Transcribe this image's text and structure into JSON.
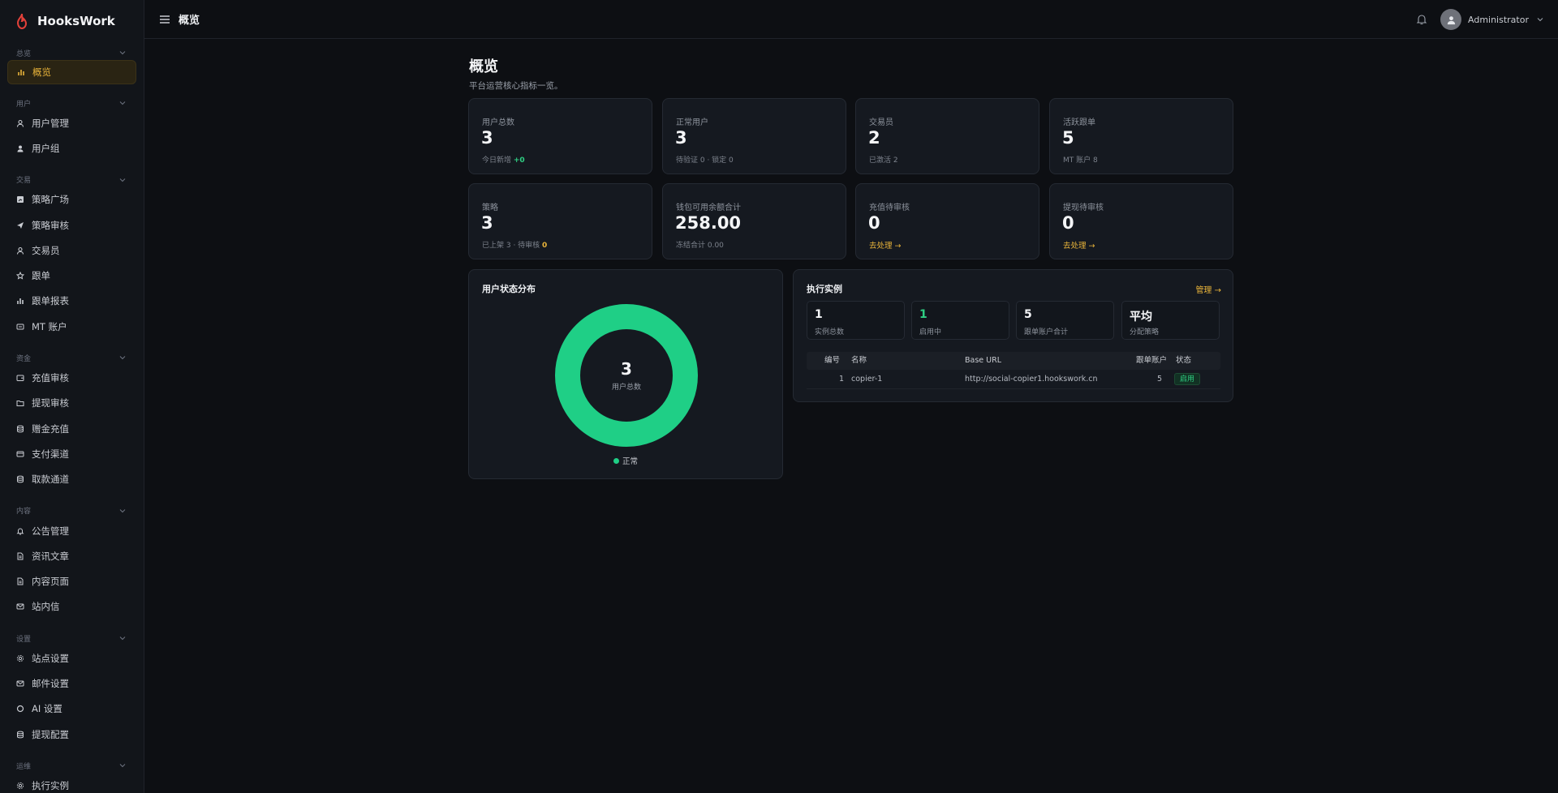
{
  "brand": {
    "name": "HooksWork"
  },
  "topbar": {
    "title": "概览",
    "user": "Administrator"
  },
  "sidebar": {
    "groups": [
      {
        "title": "总览",
        "items": [
          {
            "label": "概览",
            "icon": "bar-chart-icon",
            "active": true
          }
        ]
      },
      {
        "title": "用户",
        "items": [
          {
            "label": "用户管理",
            "icon": "user-icon"
          },
          {
            "label": "用户组",
            "icon": "users-icon"
          }
        ]
      },
      {
        "title": "交易",
        "items": [
          {
            "label": "策略广场",
            "icon": "chart-square-icon"
          },
          {
            "label": "策略审核",
            "icon": "send-icon"
          },
          {
            "label": "交易员",
            "icon": "user-icon"
          },
          {
            "label": "跟单",
            "icon": "star-icon"
          },
          {
            "label": "跟单报表",
            "icon": "bar-chart-icon"
          },
          {
            "label": "MT 账户",
            "icon": "card-icon"
          }
        ]
      },
      {
        "title": "资金",
        "items": [
          {
            "label": "充值审核",
            "icon": "wallet-icon"
          },
          {
            "label": "提现审核",
            "icon": "folder-icon"
          },
          {
            "label": "赠金充值",
            "icon": "database-icon"
          },
          {
            "label": "支付渠道",
            "icon": "credit-card-icon"
          },
          {
            "label": "取款通道",
            "icon": "database-icon"
          }
        ]
      },
      {
        "title": "内容",
        "items": [
          {
            "label": "公告管理",
            "icon": "bell-icon"
          },
          {
            "label": "资讯文章",
            "icon": "document-icon"
          },
          {
            "label": "内容页面",
            "icon": "document-icon"
          },
          {
            "label": "站内信",
            "icon": "mail-icon"
          }
        ]
      },
      {
        "title": "设置",
        "items": [
          {
            "label": "站点设置",
            "icon": "gear-icon"
          },
          {
            "label": "邮件设置",
            "icon": "mail-icon"
          },
          {
            "label": "AI 设置",
            "icon": "circle-icon"
          },
          {
            "label": "提现配置",
            "icon": "database-icon"
          }
        ]
      },
      {
        "title": "运维",
        "items": [
          {
            "label": "执行实例",
            "icon": "gear-icon"
          }
        ]
      }
    ]
  },
  "page": {
    "title": "概览",
    "subtitle": "平台运营核心指标一览。"
  },
  "stats": {
    "total_users": {
      "label": "用户总数",
      "value": "3",
      "foot_prefix": "今日新增",
      "foot_value": "+0"
    },
    "normal_users": {
      "label": "正常用户",
      "value": "3",
      "foot": "待验证 0 · 锁定 0"
    },
    "traders": {
      "label": "交易员",
      "value": "2",
      "foot": "已激活 2"
    },
    "active_copy": {
      "label": "活跃跟单",
      "value": "5",
      "foot": "MT 账户 8"
    },
    "strategies": {
      "label": "策略",
      "value": "3",
      "foot_prefix": "已上架 3 · 待审核",
      "foot_value": "0"
    },
    "wallet": {
      "label": "钱包可用余额合计",
      "value": "258.00",
      "foot": "冻结合计 0.00"
    },
    "deposit_pending": {
      "label": "充值待审核",
      "value": "0",
      "link": "去处理 →"
    },
    "withdraw_pending": {
      "label": "提现待审核",
      "value": "0",
      "link": "去处理 →"
    }
  },
  "user_status": {
    "title": "用户状态分布",
    "center_value": "3",
    "center_label": "用户总数",
    "legend": "正常"
  },
  "chart_data": {
    "type": "pie",
    "categories": [
      "正常"
    ],
    "values": [
      3
    ],
    "colors": [
      "#1fcf86"
    ],
    "title": "用户状态分布"
  },
  "instances": {
    "title": "执行实例",
    "manage_link": "管理 →",
    "summary": [
      {
        "value": "1",
        "label": "实例总数"
      },
      {
        "value": "1",
        "label": "启用中"
      },
      {
        "value": "5",
        "label": "跟单账户合计"
      },
      {
        "value": "平均",
        "label": "分配策略"
      }
    ],
    "columns": [
      "编号",
      "名称",
      "Base URL",
      "跟单账户",
      "状态"
    ],
    "rows": [
      {
        "id": "1",
        "name": "copier-1",
        "url": "http://social-copier1.hookswork.cn",
        "accounts": "5",
        "status": "启用"
      }
    ]
  }
}
